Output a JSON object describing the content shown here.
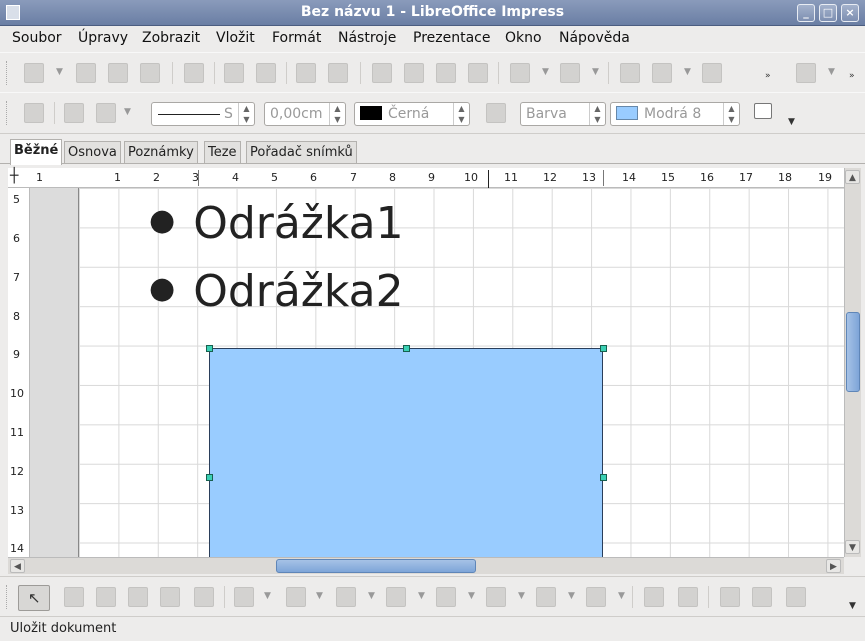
{
  "window": {
    "title": "Bez názvu 1 - LibreOffice Impress"
  },
  "menu": [
    "Soubor",
    "Úpravy",
    "Zobrazit",
    "Vložit",
    "Formát",
    "Nástroje",
    "Prezentace",
    "Okno",
    "Nápověda"
  ],
  "line_toolbar": {
    "line_style_value": "S",
    "line_width_value": "0,00cm",
    "line_color_value": "Černá",
    "area_style_value": "Barva",
    "area_color_value": "Modrá 8"
  },
  "colors": {
    "line_color": "#000000",
    "area_color": "#99ccff",
    "accent": "#7ea5d8"
  },
  "tabs": [
    "Běžné",
    "Osnova",
    "Poznámky",
    "Teze",
    "Pořadač snímků"
  ],
  "active_tab": "Běžné",
  "hruler_labels": [
    "1",
    "1",
    "2",
    "3",
    "4",
    "5",
    "6",
    "7",
    "8",
    "9",
    "10",
    "11",
    "12",
    "13",
    "14",
    "15",
    "16",
    "17",
    "18",
    "19"
  ],
  "vruler_labels": [
    "5",
    "6",
    "7",
    "8",
    "9",
    "10",
    "11",
    "12",
    "13",
    "14"
  ],
  "slide": {
    "bullets": [
      "Odrážka1",
      "Odrážka2"
    ]
  },
  "status": {
    "text": "Uložit dokument"
  }
}
